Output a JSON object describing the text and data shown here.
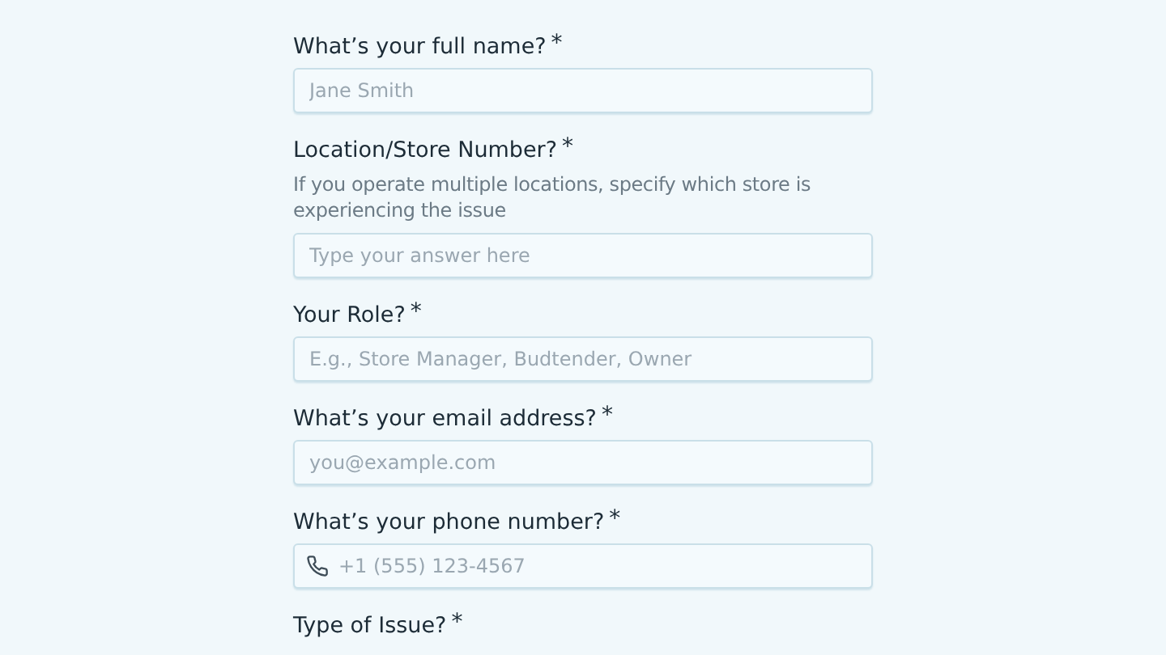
{
  "questions": [
    {
      "label": "What’s your full name?",
      "required_mark": "*",
      "placeholder": "Jane Smith",
      "kind": "text"
    },
    {
      "label": "Location/Store Number?",
      "required_mark": "*",
      "help": "If you operate multiple locations, specify which store is experiencing the issue",
      "placeholder": "Type your answer here",
      "kind": "text"
    },
    {
      "label": "Your Role?",
      "required_mark": "*",
      "placeholder": "E.g., Store Manager, Budtender, Owner",
      "kind": "text"
    },
    {
      "label": "What’s your email address?",
      "required_mark": "*",
      "placeholder": "you@example.com",
      "kind": "text"
    },
    {
      "label": "What’s your phone number?",
      "required_mark": "*",
      "placeholder": "+1 (555) 123-4567",
      "kind": "phone"
    },
    {
      "label": "Type of Issue?",
      "required_mark": "*",
      "kind": "label_only"
    }
  ]
}
